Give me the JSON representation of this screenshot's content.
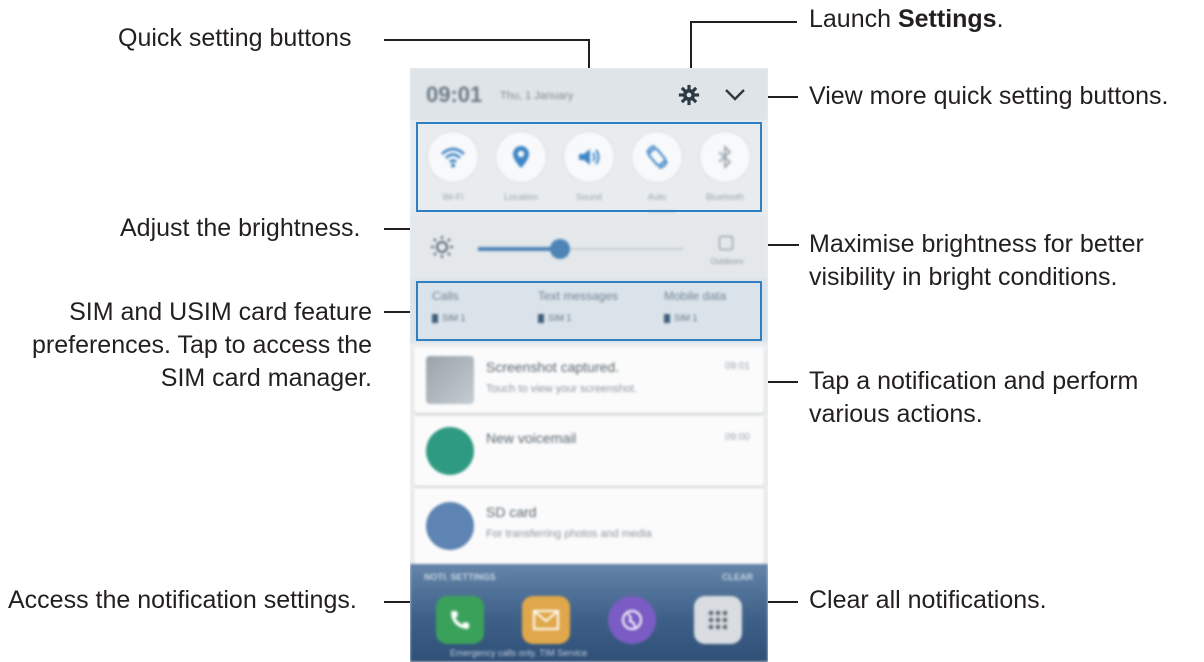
{
  "callouts": {
    "quick_setting_buttons": "Quick setting buttons",
    "launch_settings_prefix": "Launch ",
    "launch_settings_bold": "Settings",
    "launch_settings_suffix": ".",
    "view_more": "View more quick setting buttons.",
    "adjust_brightness": "Adjust the brightness.",
    "maximise_line1": "Maximise brightness for better",
    "maximise_line2": "visibility in bright conditions.",
    "sim_line1": "SIM and USIM card feature",
    "sim_line2": "preferences. Tap to access the",
    "sim_line3": "SIM card manager.",
    "tap_notification_line1": "Tap a notification and perform",
    "tap_notification_line2": "various actions.",
    "access_notification_settings": "Access the notification settings.",
    "clear_all": "Clear all notifications."
  },
  "phone": {
    "status": {
      "time": "09:01",
      "date": "Thu, 1 January"
    },
    "quick_settings": [
      {
        "label": "Wi-Fi",
        "icon": "wifi-icon"
      },
      {
        "label": "Location",
        "icon": "location-icon"
      },
      {
        "label": "Sound",
        "icon": "sound-icon"
      },
      {
        "label": "Auto",
        "icon": "auto-rotate-icon"
      },
      {
        "label": "Bluetooth",
        "icon": "bluetooth-icon"
      }
    ],
    "brightness": {
      "level": 0.4,
      "outdoor_label": "Outdoors"
    },
    "sim": [
      {
        "title": "Calls",
        "sub": "SIM 1"
      },
      {
        "title": "Text messages",
        "sub": "SIM 1"
      },
      {
        "title": "Mobile data",
        "sub": "SIM 1"
      }
    ],
    "notifications": [
      {
        "title": "Screenshot captured.",
        "sub": "Touch to view your screenshot.",
        "time": "09:01"
      },
      {
        "title": "New voicemail",
        "sub": "",
        "time": "09:00"
      },
      {
        "title": "SD card",
        "sub": "For transferring photos and media",
        "time": ""
      }
    ],
    "bottom": {
      "settings_label": "NOTI. SETTINGS",
      "clear_label": "CLEAR",
      "note": "Emergency calls only. TIM Service"
    }
  },
  "colors": {
    "accent": "#2f7fc1",
    "slider": "#4d84b5"
  }
}
